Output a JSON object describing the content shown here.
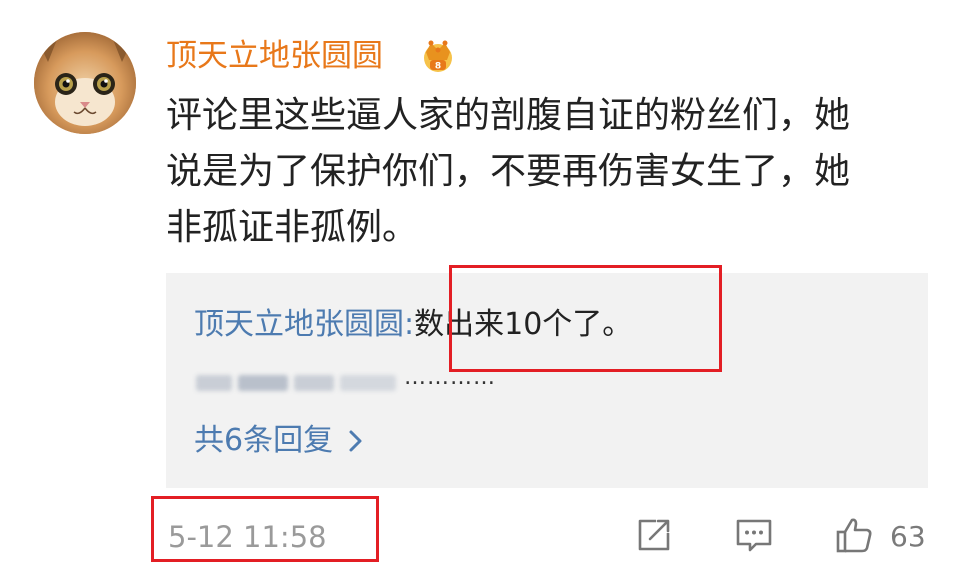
{
  "comment": {
    "username": "顶天立地张圆圆",
    "vip_icon": "crown-vip-icon",
    "text_lines": [
      "评论里这些逼人家的剖腹自证的粉丝们，她",
      "说是为了保护你们，不要再伤害女生了，她",
      "非孤证非孤例。"
    ],
    "timestamp": "5-12 11:58"
  },
  "replies": {
    "author": "顶天立地张圆圆",
    "separator": ":",
    "content": "数出来10个了。",
    "blurred_trailing": "…………",
    "more_label": "共6条回复",
    "more_icon": "chevron-right-icon"
  },
  "actions": {
    "share_icon": "share-icon",
    "comment_icon": "comment-icon",
    "like_icon": "thumbs-up-icon",
    "like_count": "63"
  },
  "colors": {
    "username": "#e8781a",
    "link_blue": "#4d7bb0",
    "highlight_red": "#e31e24",
    "reply_bg": "#f2f2f2",
    "meta_gray": "#9a9a9a"
  }
}
